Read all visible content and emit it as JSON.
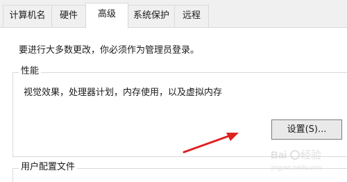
{
  "tabs": [
    {
      "label": "计算机名",
      "active": false
    },
    {
      "label": "硬件",
      "active": false
    },
    {
      "label": "高级",
      "active": true
    },
    {
      "label": "系统保护",
      "active": false
    },
    {
      "label": "远程",
      "active": false
    }
  ],
  "advanced": {
    "admin_notice": "要进行大多数更改，你必须作为管理员登录。",
    "performance": {
      "title": "性能",
      "description": "视觉效果，处理器计划，内存使用，以及虚拟内存",
      "settings_button": "设置(S)..."
    },
    "user_profiles": {
      "title": "用户配置文件"
    }
  },
  "annotation": {
    "arrow_color": "#e02020"
  },
  "watermark": {
    "text": "Baidu 经验",
    "url": "jingyan.baidu.com"
  }
}
